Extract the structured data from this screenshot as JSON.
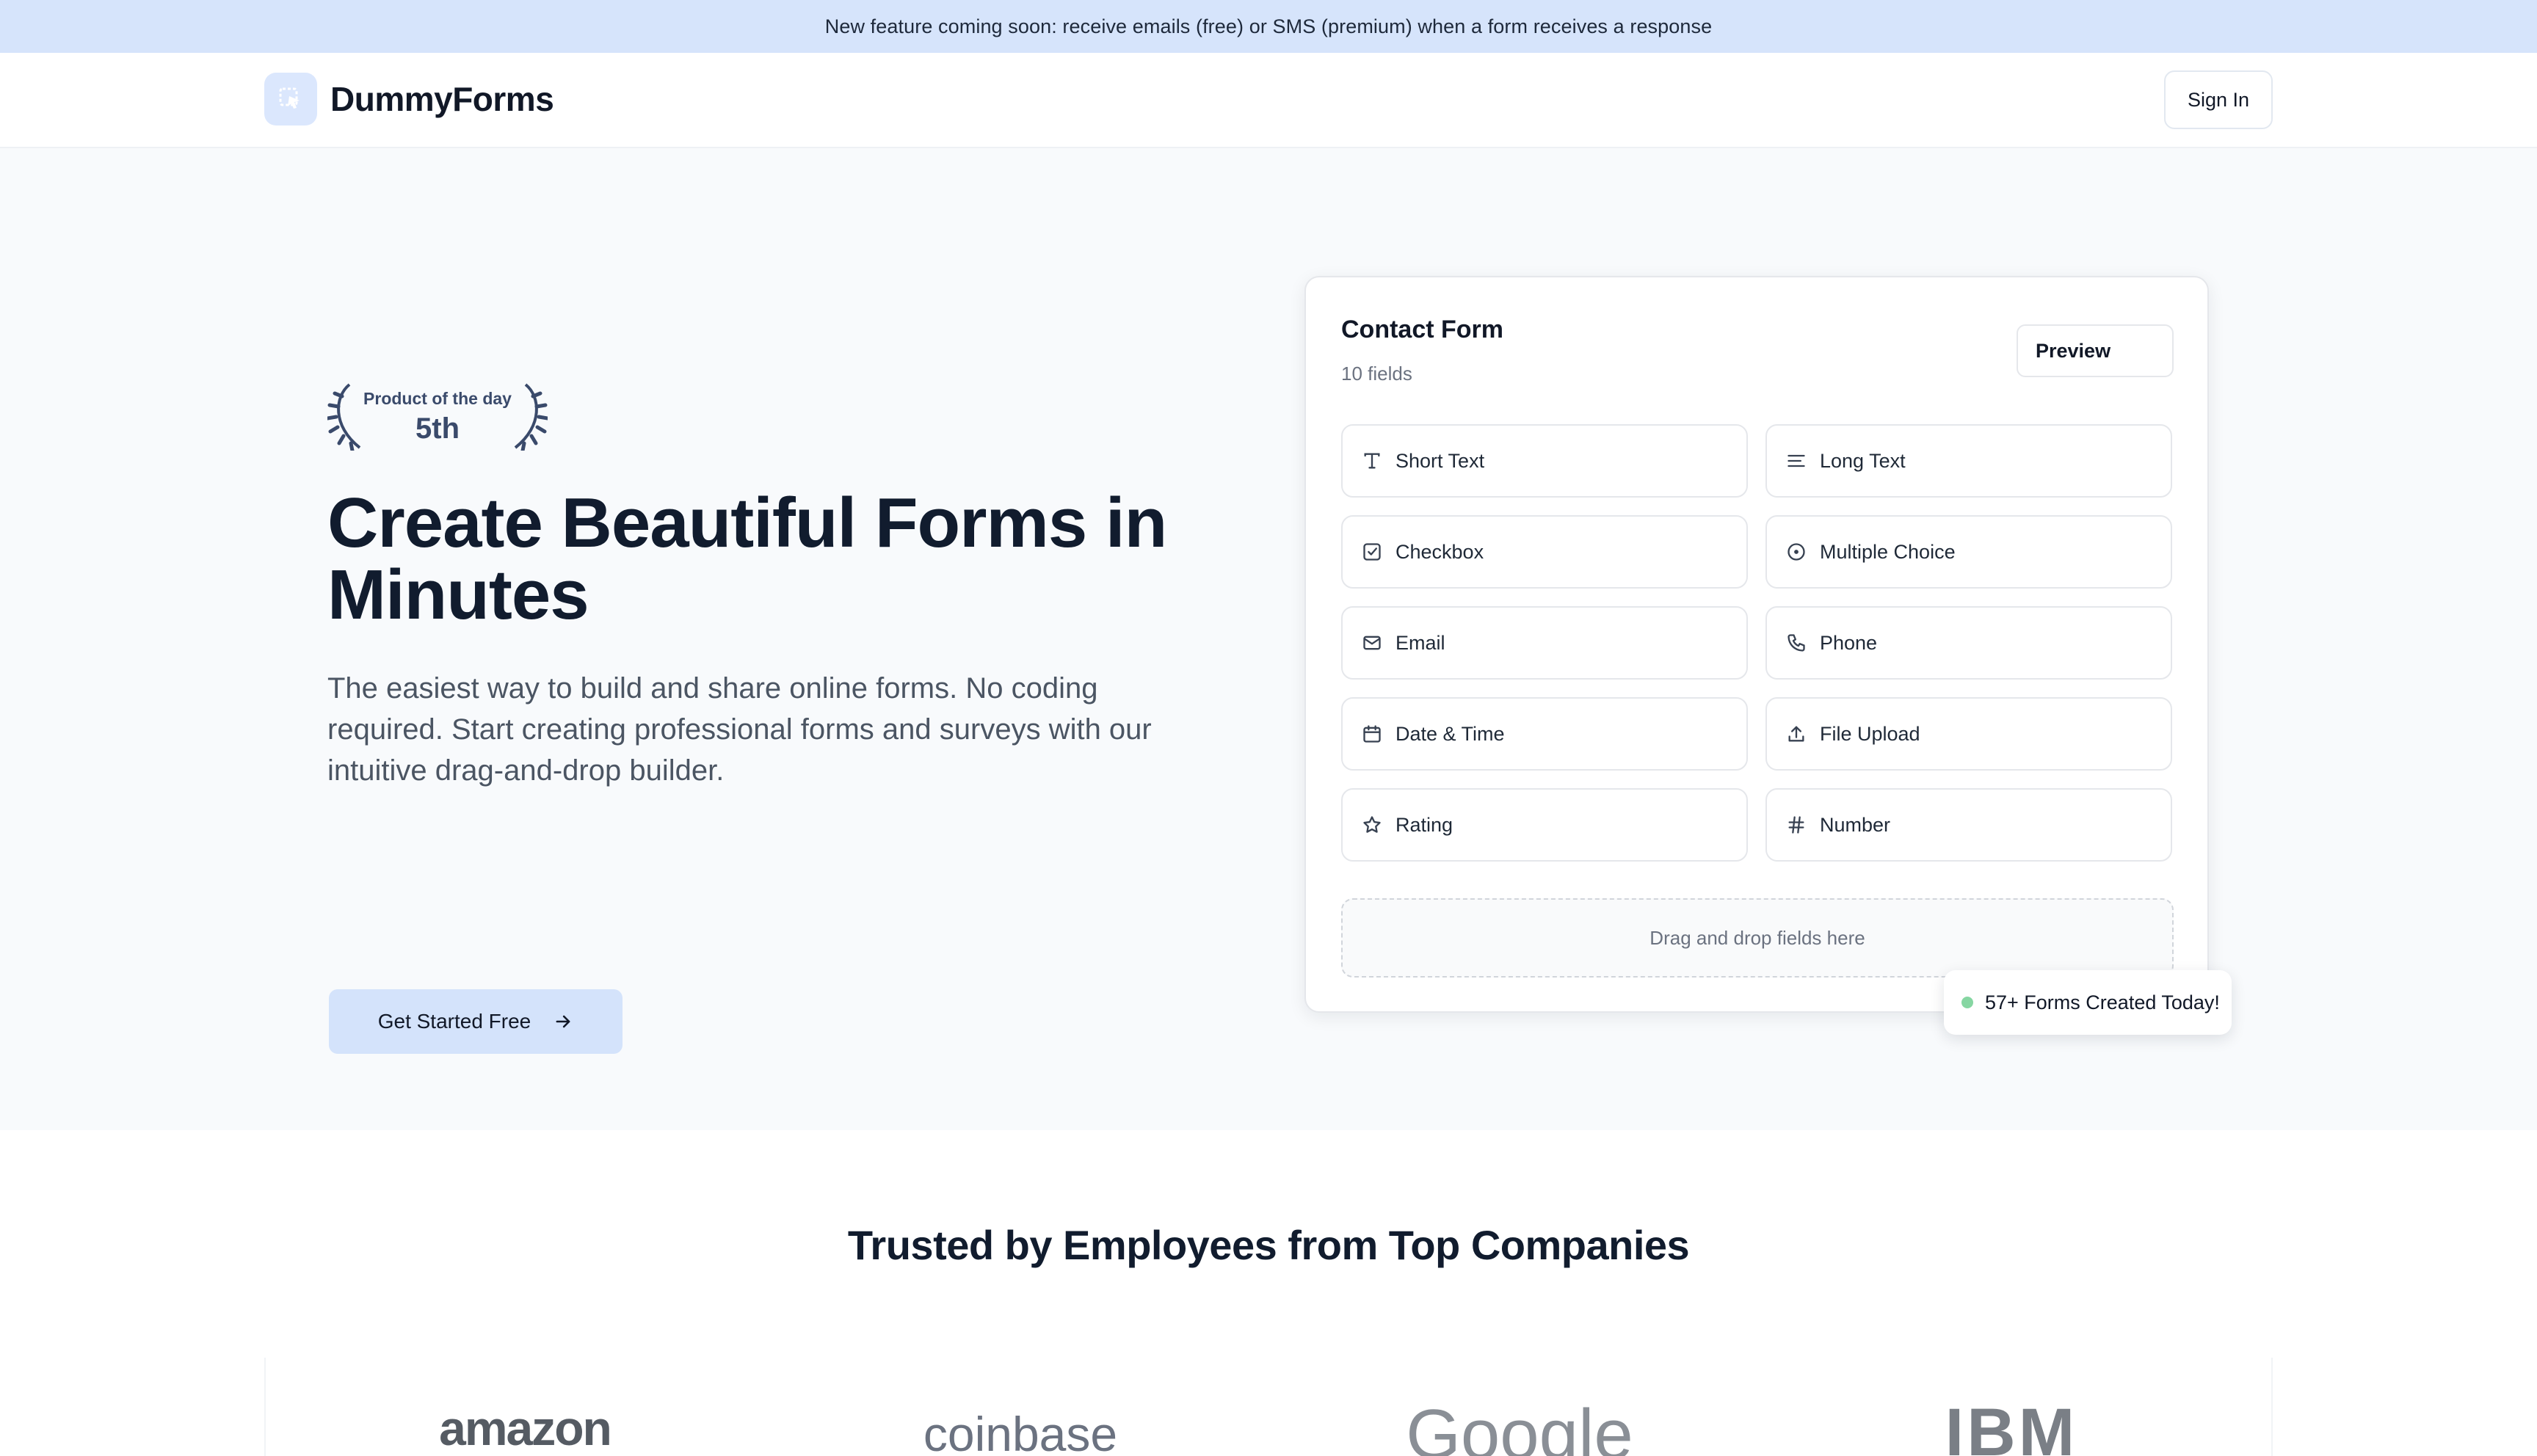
{
  "banner": {
    "text": "New feature coming soon: receive emails (free) or SMS (premium) when a form receives a response"
  },
  "nav": {
    "brand": "DummyForms",
    "signin_label": "Sign In"
  },
  "hero": {
    "award_label": "Product of the day",
    "award_rank": "5th",
    "title": "Create Beautiful Forms in Minutes",
    "subtitle": "The easiest way to build and share online forms. No coding required. Start creating professional forms and surveys with our intuitive drag-and-drop builder.",
    "cta_label": "Get Started Free"
  },
  "form_card": {
    "title": "Contact Form",
    "field_count": "10 fields",
    "preview_label": "Preview",
    "fields": [
      {
        "label": "Short Text",
        "icon": "text-icon"
      },
      {
        "label": "Long Text",
        "icon": "align-left-icon"
      },
      {
        "label": "Checkbox",
        "icon": "checkbox-icon"
      },
      {
        "label": "Multiple Choice",
        "icon": "radio-icon"
      },
      {
        "label": "Email",
        "icon": "mail-icon"
      },
      {
        "label": "Phone",
        "icon": "phone-icon"
      },
      {
        "label": "Date & Time",
        "icon": "calendar-icon"
      },
      {
        "label": "File Upload",
        "icon": "upload-icon"
      },
      {
        "label": "Rating",
        "icon": "star-icon"
      },
      {
        "label": "Number",
        "icon": "hash-icon"
      }
    ],
    "dropzone_text": "Drag and drop fields here"
  },
  "toast": {
    "text": "57+ Forms Created Today!"
  },
  "trusted": {
    "title": "Trusted by Employees from Top Companies",
    "companies": [
      "amazon",
      "coinbase",
      "Google",
      "IBM"
    ]
  },
  "colors": {
    "banner_bg": "#d6e4fb",
    "accent": "#d4e3fb",
    "hero_bg": "#f8fafc",
    "toast_dot": "#86d6a2"
  }
}
